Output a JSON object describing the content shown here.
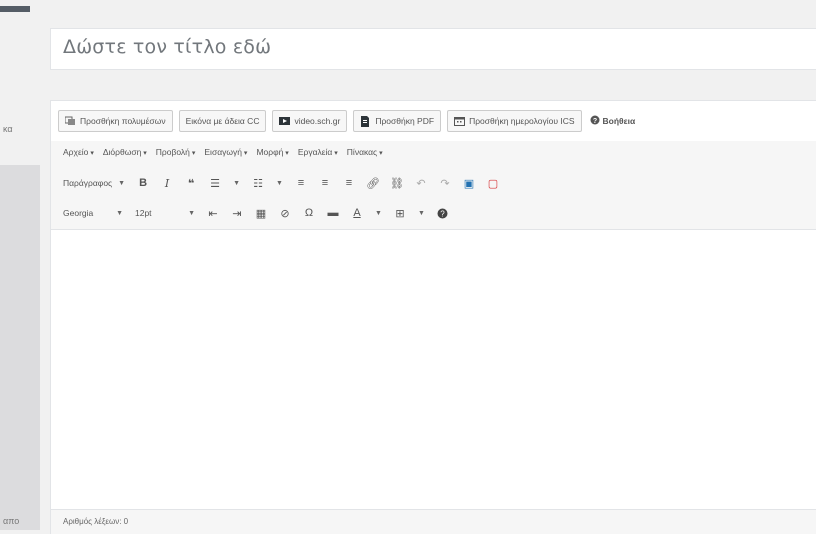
{
  "sidebar": {
    "label_a": "κα",
    "label_b": "απο"
  },
  "title": {
    "placeholder": "Δώστε τον τίτλο εδώ"
  },
  "media_buttons": [
    {
      "label": "Προσθήκη πολυμέσων",
      "icon": "media-icon"
    },
    {
      "label": "Εικόνα με άδεια CC",
      "icon": ""
    },
    {
      "label": "video.sch.gr",
      "icon": "video-icon"
    },
    {
      "label": "Προσθήκη PDF",
      "icon": "pdf-icon"
    },
    {
      "label": "Προσθήκη ημερολογίου ICS",
      "icon": "calendar-icon"
    }
  ],
  "help": {
    "label": "Βοήθεια"
  },
  "menubar": [
    "Αρχείο",
    "Διόρθωση",
    "Προβολή",
    "Εισαγωγή",
    "Μορφή",
    "Εργαλεία",
    "Πίνακας"
  ],
  "toolbar": {
    "format_select": "Παράγραφος",
    "font_select": "Georgia",
    "size_select": "12pt"
  },
  "status": {
    "word_count": "Αριθμός λέξεων: 0"
  },
  "colors": {
    "accent": "#2271b1",
    "danger": "#d63638"
  }
}
